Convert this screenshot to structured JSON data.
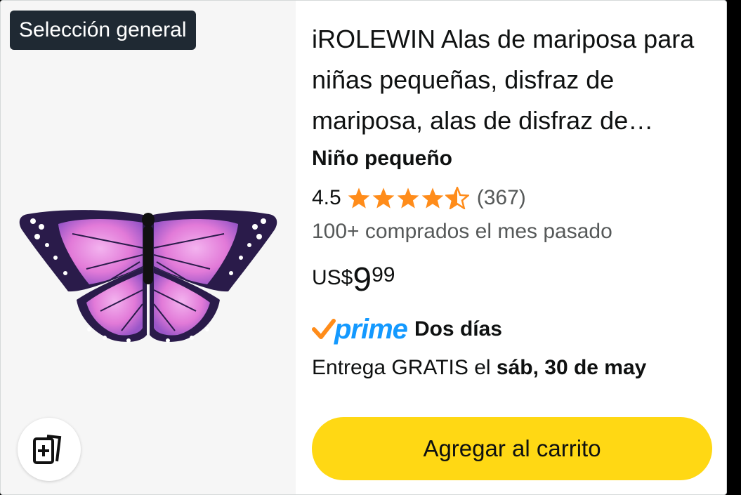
{
  "badge": {
    "label": "Selección general"
  },
  "product": {
    "title": "iROLEWIN Alas de mariposa para niñas pequeñas, disfraz de mariposa, alas de disfraz de…",
    "size": "Niño pequeño",
    "rating": "4.5",
    "rating_stars": 4.5,
    "review_count": "(367)",
    "bought": "100+ comprados el mes pasado",
    "price": {
      "currency": "US$",
      "whole": "9",
      "fraction": "99"
    },
    "prime": {
      "logo_text": "prime",
      "label": "Dos días"
    },
    "delivery": {
      "prefix": "Entrega GRATIS el",
      "date": "sáb, 30 de may"
    },
    "image": {
      "icon": "butterfly-wings-image"
    }
  },
  "actions": {
    "add_to_cart": "Agregar al carrito",
    "compare_icon": "add-to-compare-icon"
  },
  "colors": {
    "star": "#ff8c1a",
    "prime_blue": "#1399ff",
    "prime_check": "#ff8c1a",
    "cart_button": "#ffd814",
    "badge_bg": "#1f2933"
  }
}
